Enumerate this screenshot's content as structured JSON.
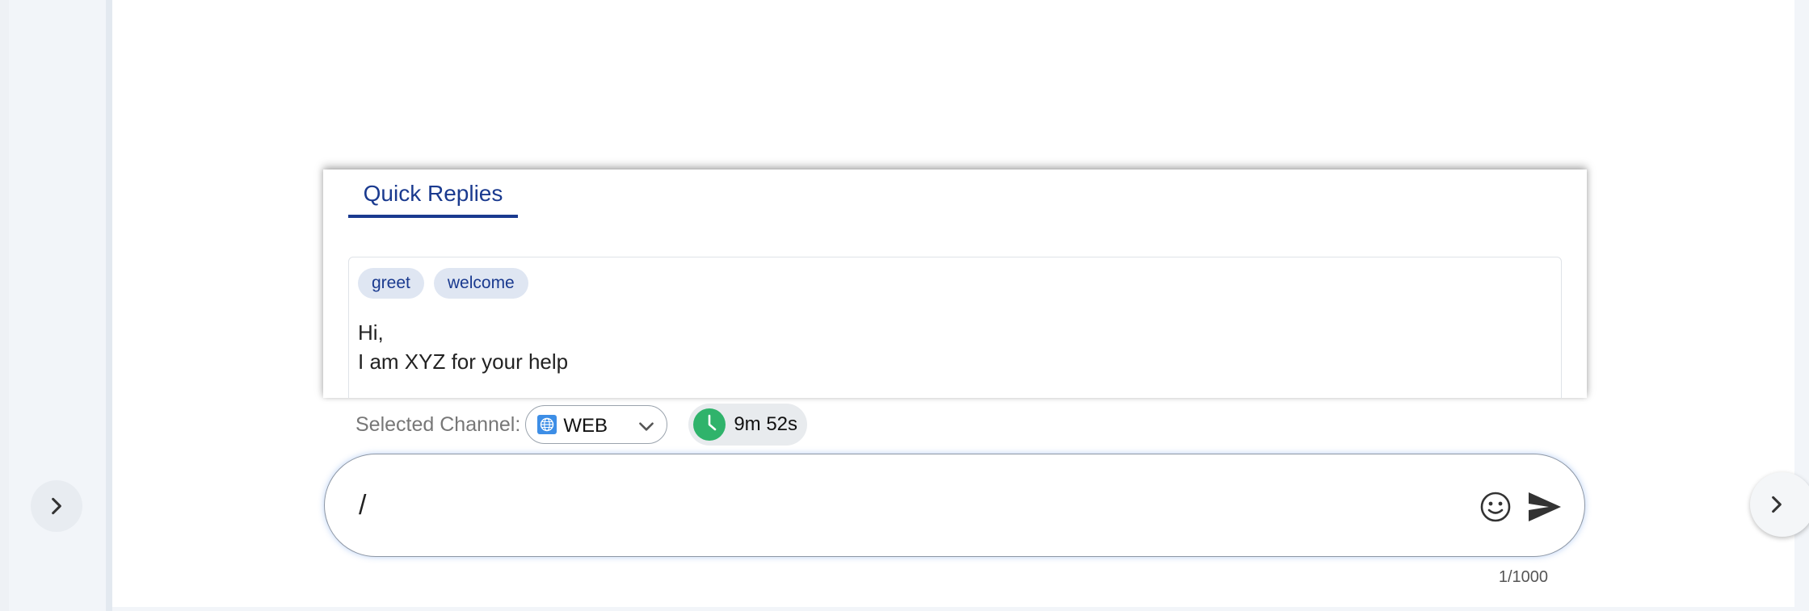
{
  "quick_replies": {
    "tab_label": "Quick Replies",
    "items": [
      {
        "tags": [
          "greet",
          "welcome"
        ],
        "lines": [
          "Hi,",
          "I am XYZ for your help"
        ]
      }
    ]
  },
  "channel": {
    "label": "Selected Channel:",
    "selected": "WEB",
    "icon": "globe-icon"
  },
  "timer": {
    "value": "9m 52s",
    "icon": "clock-icon",
    "icon_color": "#2fb36b"
  },
  "composer": {
    "value": "/",
    "char_count": "1/1000"
  },
  "colors": {
    "accent": "#1a3a8f",
    "tag_bg": "#dfe6f2"
  },
  "nav": {
    "left_toggle_icon": "chevron-right-icon",
    "right_toggle_icon": "chevron-right-icon"
  }
}
